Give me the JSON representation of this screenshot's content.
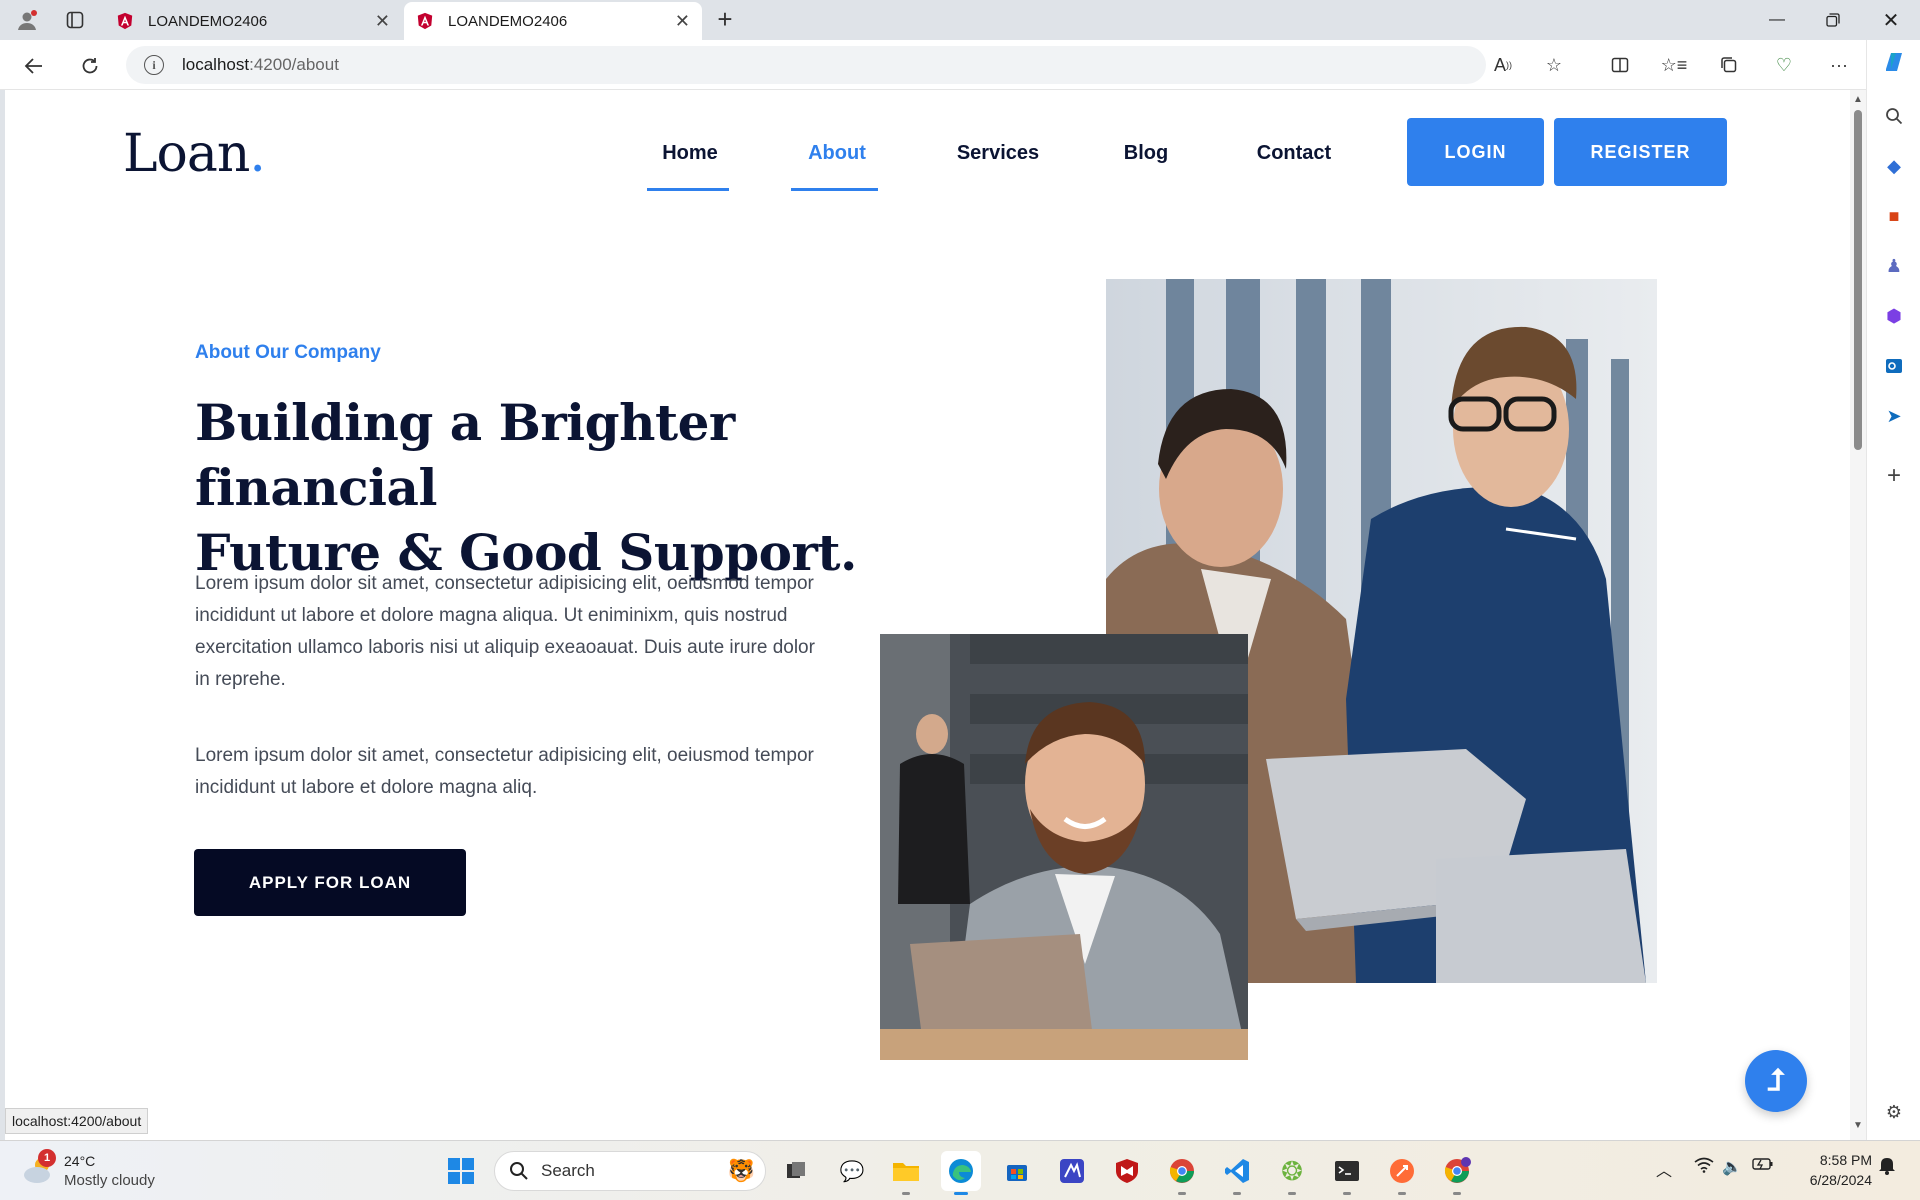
{
  "browser": {
    "tabs": [
      {
        "title": "LOANDEMO2406",
        "active": false
      },
      {
        "title": "LOANDEMO2406",
        "active": true
      }
    ],
    "url_host": "localhost",
    "url_path": ":4200/about",
    "status_url": "localhost:4200/about"
  },
  "site": {
    "logo_text": "Loan",
    "logo_dot": ".",
    "nav": {
      "home": "Home",
      "about": "About",
      "services": "Services",
      "blog": "Blog",
      "contact": "Contact",
      "active": "About"
    },
    "login_label": "LOGIN",
    "register_label": "REGISTER"
  },
  "hero": {
    "eyebrow": "About Our Company",
    "headline_line1": "Building a Brighter financial",
    "headline_line2": "Future & Good Support.",
    "paragraph1": "Lorem ipsum dolor sit amet, consectetur adipisicing elit, oeiusmod tempor incididunt ut labore et dolore magna aliqua. Ut eniminixm, quis nostrud exercitation ullamco laboris nisi ut aliquip exeaoauat. Duis aute irure dolor in reprehe.",
    "paragraph2": "Lorem ipsum dolor sit amet, consectetur adipisicing elit, oeiusmod tempor incididunt ut labore et dolore magna aliq.",
    "apply_label": "APPLY FOR LOAN"
  },
  "colors": {
    "accent": "#2f80ed",
    "navy": "#0b1433",
    "button_dark": "#050a24"
  },
  "taskbar": {
    "weather_badge": "1",
    "temperature": "24°C",
    "condition": "Mostly cloudy",
    "search_label": "Search",
    "time": "8:58 PM",
    "date": "6/28/2024"
  }
}
